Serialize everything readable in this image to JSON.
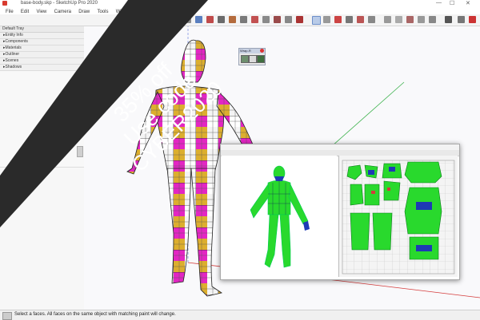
{
  "window": {
    "title": "base-body.skp - SketchUp Pro 2020",
    "controls": [
      "—",
      "☐",
      "✕"
    ]
  },
  "menu": [
    "File",
    "Edit",
    "View",
    "Camera",
    "Draw",
    "Tools",
    "Window"
  ],
  "tray": {
    "title": "Default Tray",
    "panels": [
      "Entity Info",
      "Components",
      "Materials",
      "Outliner",
      "Scenes",
      "Shadows"
    ]
  },
  "palette": {
    "title": "Wrap-R"
  },
  "status": {
    "message": "Select a faces. All faces on the same object with matching paint will change."
  },
  "promo": {
    "line1": "35% off",
    "line2": "Use code",
    "line3": "CYBER2020",
    "color": "#2a2a2a"
  },
  "colors": {
    "checker_a": "#e326c3",
    "checker_b": "#dcae2e",
    "uv_green": "#29d92d",
    "uv_blue": "#1e3ab5",
    "axis_red": "#d43b3b",
    "axis_green": "#3fb34f"
  }
}
